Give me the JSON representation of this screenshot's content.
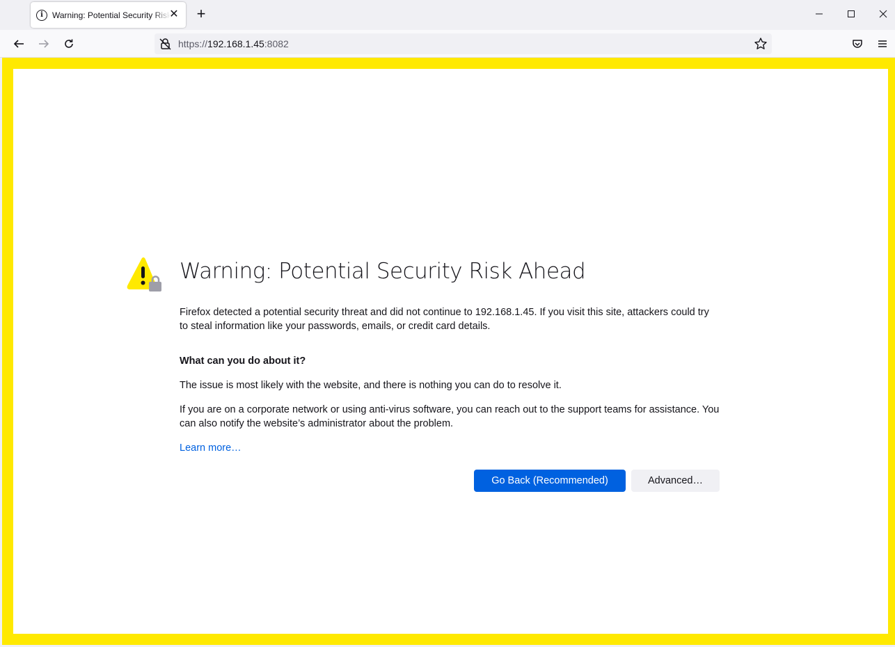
{
  "tab": {
    "title": "Warning: Potential Security Risk Ahead",
    "icon": "info-icon",
    "close_glyph": "✕"
  },
  "new_tab_glyph": "+",
  "urlbar": {
    "scheme": "https://",
    "host": "192.168.1.45",
    "port": ":8082"
  },
  "error_page": {
    "title": "Warning: Potential Security Risk Ahead",
    "intro": "Firefox detected a potential security threat and did not continue to 192.168.1.45. If you visit this site, attackers could try to steal information like your passwords, emails, or credit card details.",
    "what_heading": "What can you do about it?",
    "what_p1": "The issue is most likely with the website, and there is nothing you can do to resolve it.",
    "what_p2": "If you are on a corporate network or using anti-virus software, you can reach out to the support teams for assistance. You can also notify the website’s administrator about the problem.",
    "learn_more": "Learn more…",
    "go_back_label": "Go Back (Recommended)",
    "advanced_label": "Advanced…"
  },
  "colors": {
    "highlight_border": "#ffe900",
    "primary_button": "#0061e0",
    "link": "#0061e0"
  }
}
